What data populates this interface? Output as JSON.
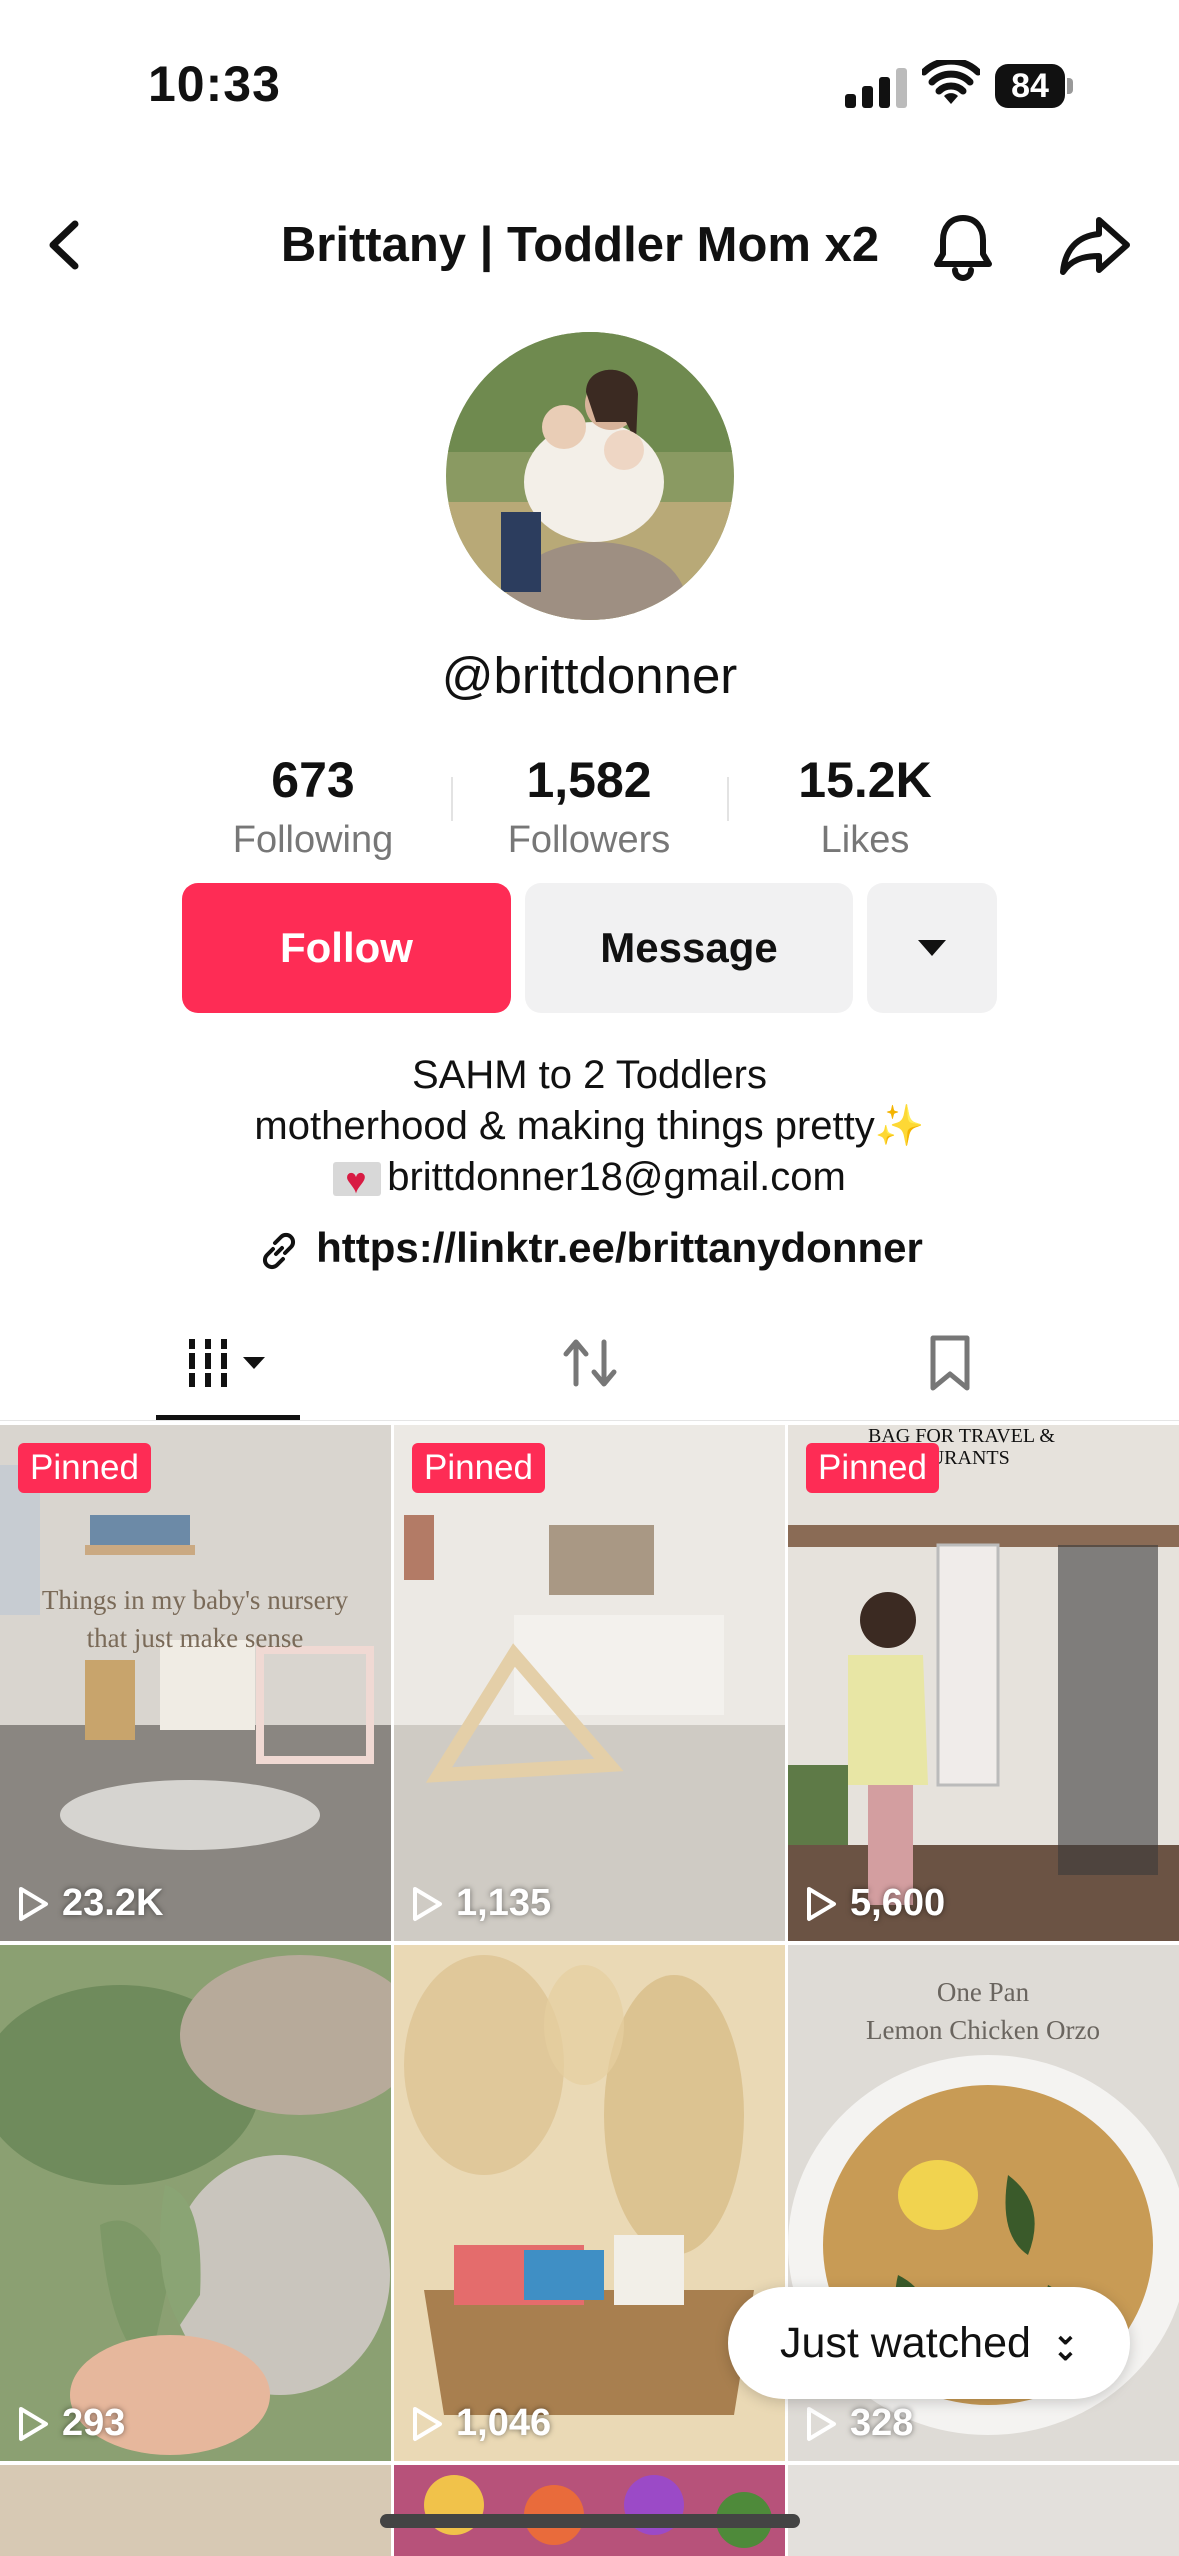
{
  "status_bar": {
    "time": "10:33",
    "battery": "84"
  },
  "header": {
    "title": "Brittany | Toddler Mom x2"
  },
  "profile": {
    "username": "@brittdonner",
    "stats": [
      {
        "value": "673",
        "label": "Following"
      },
      {
        "value": "1,582",
        "label": "Followers"
      },
      {
        "value": "15.2K",
        "label": "Likes"
      }
    ]
  },
  "actions": {
    "follow": "Follow",
    "message": "Message"
  },
  "bio": {
    "line1": "SAHM to 2 Toddlers",
    "line2": "motherhood & making things pretty",
    "line2_emoji": "✨",
    "email": "brittdonner18@gmail.com",
    "link": "https://linktr.ee/brittanydonner"
  },
  "tabs": [
    "videos-icon",
    "reposts-icon",
    "favorites-icon"
  ],
  "videos": [
    {
      "pinned_label": "Pinned",
      "views": "23.2K",
      "overlay": "Things in my baby's nursery that just make sense"
    },
    {
      "pinned_label": "Pinned",
      "views": "1,135"
    },
    {
      "pinned_label": "Pinned",
      "views": "5,600",
      "overlay": "BAG FOR TRAVEL & RESTAURANTS"
    },
    {
      "views": "293"
    },
    {
      "views": "1,046"
    },
    {
      "views": "328",
      "overlay1": "One Pan",
      "overlay2": "Lemon Chicken Orzo"
    }
  ],
  "just_watched": "Just watched",
  "colors": {
    "accent": "#fe2c55",
    "button_gray": "#f1f1f2"
  }
}
